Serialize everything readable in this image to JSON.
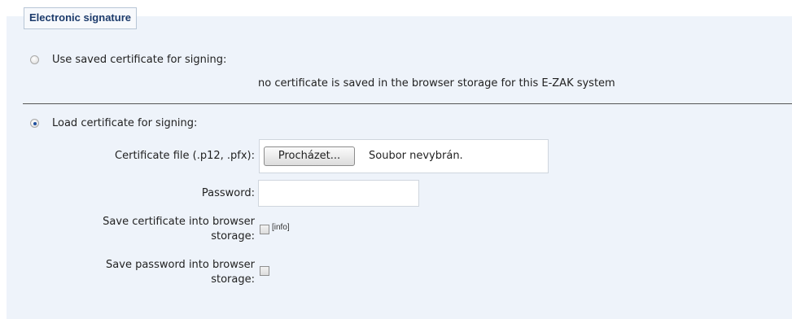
{
  "fieldset": {
    "legend": "Electronic signature"
  },
  "saved_option": {
    "label": "Use saved certificate for signing:",
    "status": "no certificate is saved in the browser storage for this E-ZAK system",
    "selected": false
  },
  "load_option": {
    "label": "Load certificate for signing:",
    "selected": true,
    "certificate_file": {
      "label": "Certificate file (.p12, .pfx):",
      "browse_button": "Procházet...",
      "file_status": "Soubor nevybrán."
    },
    "password": {
      "label": "Password:",
      "value": ""
    },
    "save_certificate": {
      "label_line1": "Save certificate into browser",
      "label_line2": "storage:",
      "checked": false,
      "info_link": "[info]"
    },
    "save_password": {
      "label_line1": "Save password into browser",
      "label_line2": "storage:",
      "checked": false
    }
  }
}
